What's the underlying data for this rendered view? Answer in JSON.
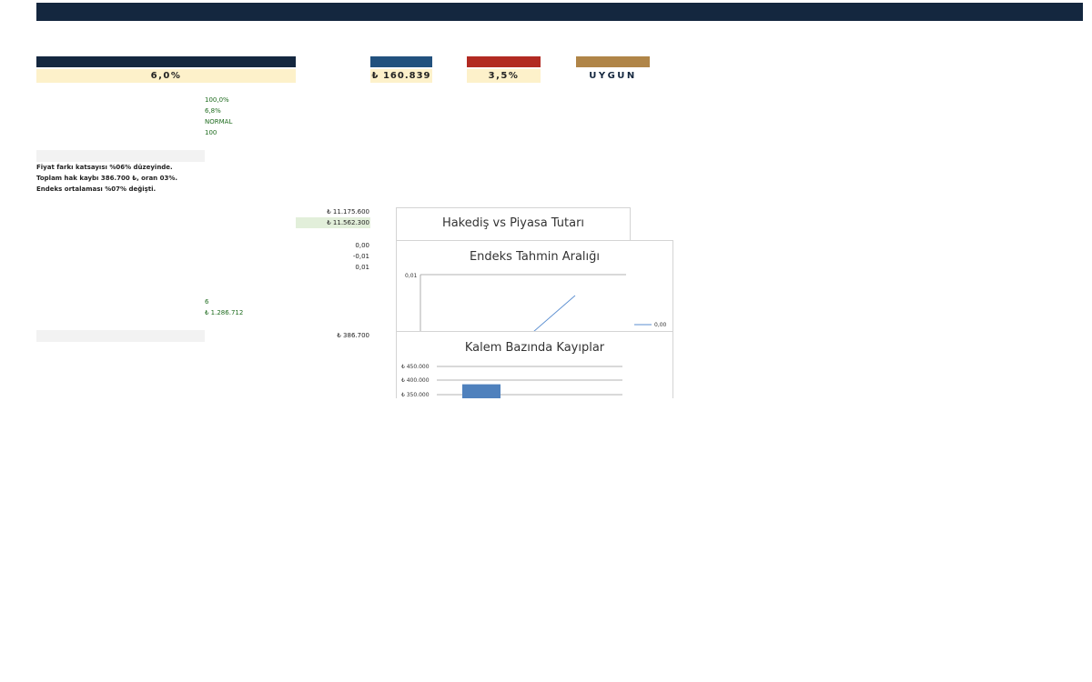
{
  "kpis": {
    "rate": "6,0%",
    "amount": "₺ 160.839",
    "percent": "3,5%",
    "status": "UYGUN"
  },
  "params": [
    "100,0%",
    "6,8%",
    "NORMAL",
    "100"
  ],
  "notes": [
    "Fiyat farkı katsayısı %06% düzeyinde.",
    "Toplam hak kaybı 386.700 ₺, oran 03%.",
    "Endeks ortalaması %07% değişti."
  ],
  "values": {
    "v1": "₺ 11.175.600",
    "v2": "₺ 11.562.300",
    "v3": "0,00",
    "v4": "-0,01",
    "v5": "0,01",
    "v6": "₺ 386.700"
  },
  "counts": {
    "count": "6",
    "total": "₺ 1.286.712"
  },
  "charts": {
    "hakedis_title": "Hakediş vs Piyasa Tutarı",
    "endeks_title": "Endeks Tahmin Aralığı",
    "kalem_title": "Kalem Bazında Kayıplar"
  },
  "chart_data": [
    {
      "type": "line",
      "title": "Endeks Tahmin Aralığı",
      "y_ticks": [
        "0,01"
      ],
      "legend": [
        "0,00"
      ],
      "series": [
        {
          "name": "0,00",
          "x": [
            0.55,
            0.75
          ],
          "y": [
            0.0,
            0.01
          ]
        }
      ],
      "ylim": [
        0,
        0.01
      ]
    },
    {
      "type": "bar",
      "title": "Kalem Bazında Kayıplar",
      "y_ticks": [
        "₺ 450.000",
        "₺ 400.000",
        "₺ 350.000"
      ],
      "ylim": [
        350000,
        450000
      ],
      "values": [
        386700
      ]
    }
  ],
  "colors": {
    "navy": "#14273f",
    "blue": "#22517e",
    "red": "#b22a22",
    "gold": "#b08548",
    "cream": "#fdf1ca",
    "green_cell": "#e2efda",
    "gray_cell": "#f2f2f2",
    "line": "#5b8fd1",
    "bar": "#4f81bd"
  }
}
